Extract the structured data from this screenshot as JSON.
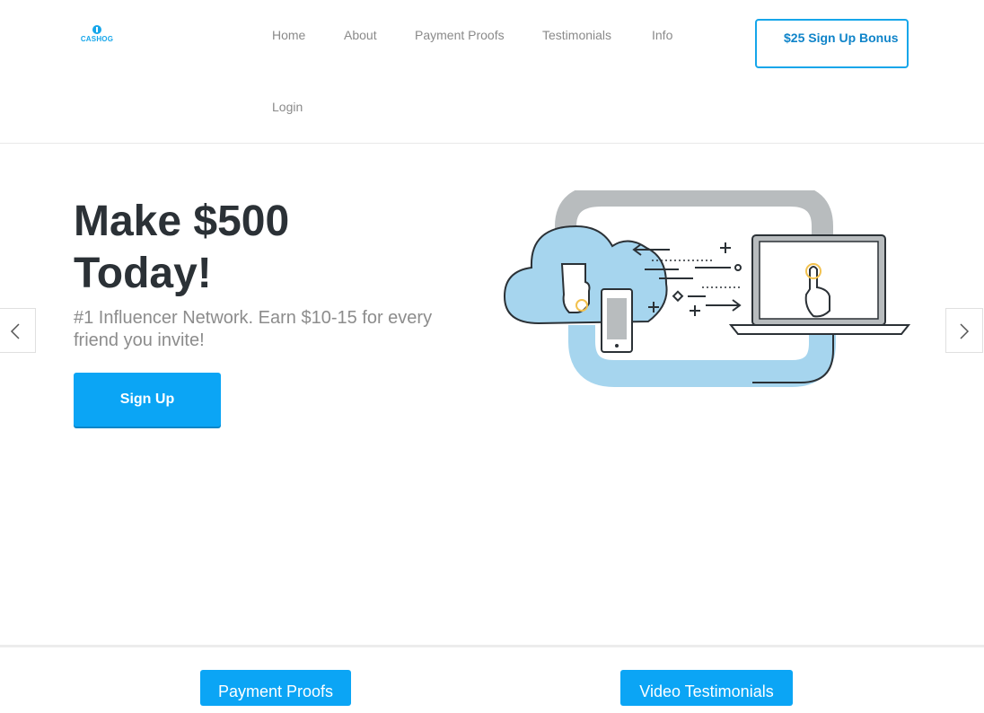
{
  "brand": {
    "logo_text": "CASHOG",
    "accent_color": "#16a6ea"
  },
  "nav": {
    "items": [
      {
        "label": "Home"
      },
      {
        "label": "About"
      },
      {
        "label": "Payment Proofs"
      },
      {
        "label": "Testimonials"
      },
      {
        "label": "Info"
      },
      {
        "label": "Login"
      }
    ],
    "bonus_button": "$25 Sign Up Bonus"
  },
  "hero": {
    "title": "Make $500 Today!",
    "subtitle": "#1 Influencer Network. Earn $10-15 for every friend you invite!",
    "cta_label": "Sign Up",
    "prev_icon": "chevron-left-icon",
    "next_icon": "chevron-right-icon",
    "illustration_icon": "cloud-devices-sync-illustration"
  },
  "sections": {
    "payment_proofs_label": "Payment Proofs",
    "video_testimonials_label": "Video Testimonials"
  }
}
